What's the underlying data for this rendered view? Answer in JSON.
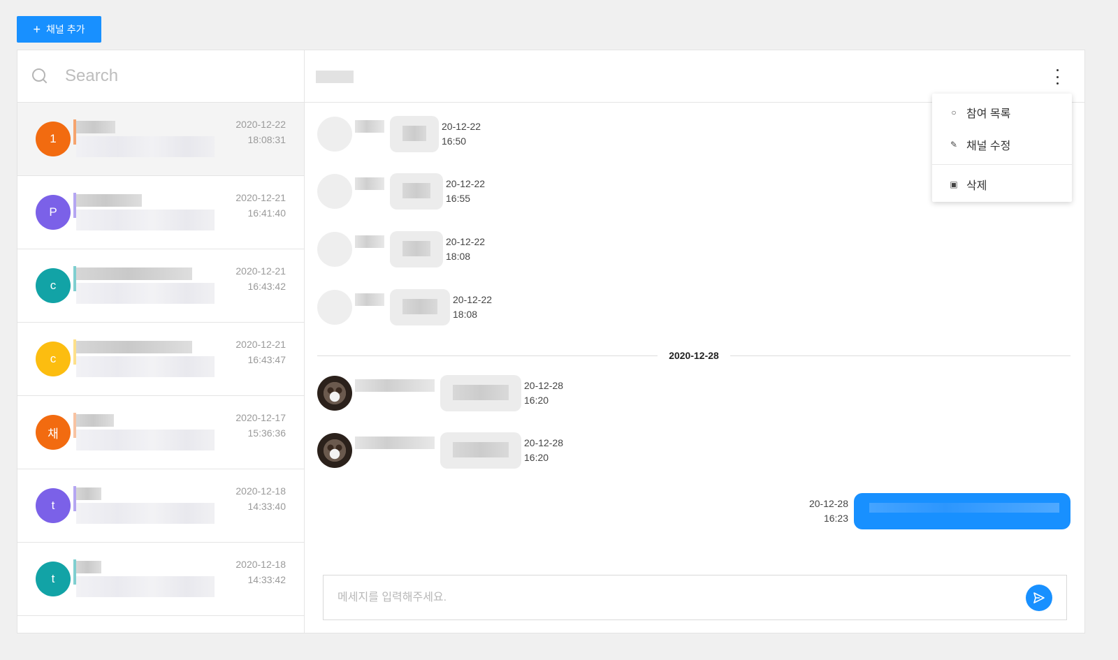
{
  "toolbar": {
    "add_channel_label": "채널 추가",
    "add_icon": "plus-icon"
  },
  "search": {
    "placeholder": "Search",
    "icon": "search-icon"
  },
  "channels": [
    {
      "initial": "1",
      "color": "#f26b10",
      "bar_color": "#f6a46e",
      "date": "2020-12-22",
      "time": "18:08:31"
    },
    {
      "initial": "P",
      "color": "#7b61e8",
      "bar_color": "#b5a6f2",
      "date": "2020-12-21",
      "time": "16:41:40"
    },
    {
      "initial": "c",
      "color": "#12a3a6",
      "bar_color": "#7fcfd0",
      "date": "2020-12-21",
      "time": "16:43:42"
    },
    {
      "initial": "c",
      "color": "#fcbd10",
      "bar_color": "#fde08a",
      "date": "2020-12-21",
      "time": "16:43:47"
    },
    {
      "initial": "채",
      "color": "#f26b10",
      "bar_color": "#f8c3a2",
      "date": "2020-12-17",
      "time": "15:36:36"
    },
    {
      "initial": "t",
      "color": "#7b61e8",
      "bar_color": "#b5a6f2",
      "date": "2020-12-18",
      "time": "14:33:40"
    },
    {
      "initial": "t",
      "color": "#12a3a6",
      "bar_color": "#7fcfd0",
      "date": "2020-12-18",
      "time": "14:33:42"
    }
  ],
  "menu": {
    "items": [
      {
        "label": "참여 목록",
        "icon": "user-icon"
      },
      {
        "label": "채널 수정",
        "icon": "edit-icon"
      },
      {
        "label": "삭제",
        "icon": "trash-icon"
      }
    ]
  },
  "messages": [
    {
      "date": "20-12-22",
      "time": "16:50"
    },
    {
      "date": "20-12-22",
      "time": "16:55"
    },
    {
      "date": "20-12-22",
      "time": "18:08"
    },
    {
      "date": "20-12-22",
      "time": "18:08"
    },
    {
      "date": "20-12-28",
      "time": "16:20"
    },
    {
      "date": "20-12-28",
      "time": "16:20"
    }
  ],
  "date_divider": "2020-12-28",
  "my_message": {
    "date": "20-12-28",
    "time": "16:23"
  },
  "composer": {
    "placeholder": "메세지를 입력해주세요.",
    "send_icon": "send-icon"
  },
  "colors": {
    "accent": "#1890ff",
    "background": "#f0f0f0"
  }
}
